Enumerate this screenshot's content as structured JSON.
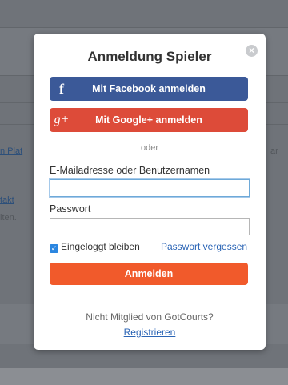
{
  "background": {
    "link_left_1": "n Plat",
    "link_left_2": "takt",
    "text_left_3": "iten.",
    "text_right_1": "ar"
  },
  "modal": {
    "title": "Anmeldung Spieler",
    "close_icon": "close-icon",
    "facebook_label": "Mit Facebook anmelden",
    "facebook_icon_glyph": "f",
    "google_label": "Mit Google+ anmelden",
    "google_icon_glyph": "g+",
    "separator": "oder",
    "email_label": "E-Mailadresse oder Benutzernamen",
    "email_value": "",
    "password_label": "Passwort",
    "password_value": "",
    "remember_label": "Eingeloggt bleiben",
    "remember_checked": true,
    "forgot_link": "Passwort vergessen",
    "submit_label": "Anmelden",
    "footer_text": "Nicht Mitglied von GotCourts?",
    "register_link": "Registrieren"
  },
  "colors": {
    "facebook": "#3b5998",
    "google": "#dd4b39",
    "submit": "#f15a2b",
    "link": "#2a64b5"
  }
}
